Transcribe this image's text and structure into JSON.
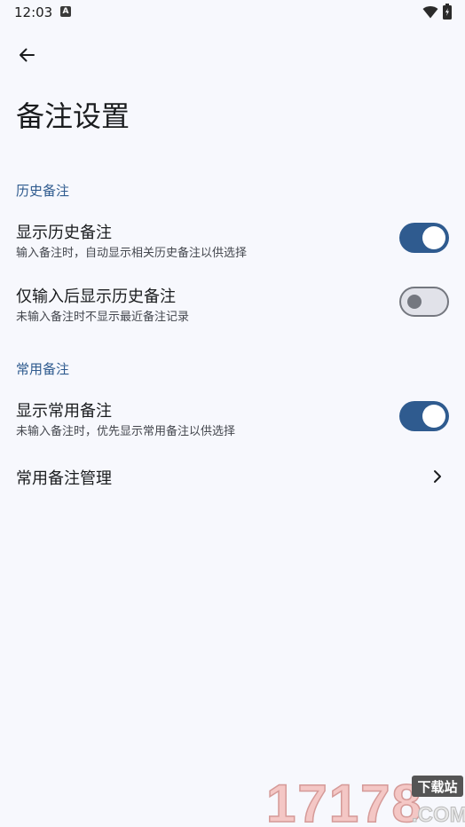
{
  "status_bar": {
    "time": "12:03",
    "notification_icon": "A"
  },
  "header": {
    "title": "备注设置"
  },
  "sections": [
    {
      "title": "历史备注",
      "items": [
        {
          "title": "显示历史备注",
          "summary": "输入备注时，自动显示相关历史备注以供选择",
          "enabled": true
        },
        {
          "title": "仅输入后显示历史备注",
          "summary": "未输入备注时不显示最近备注记录",
          "enabled": false
        }
      ]
    },
    {
      "title": "常用备注",
      "items": [
        {
          "title": "显示常用备注",
          "summary": "未输入备注时，优先显示常用备注以供选择",
          "enabled": true
        },
        {
          "title": "常用备注管理"
        }
      ]
    }
  ],
  "watermark": {
    "number": "17178",
    "tag": "下载站",
    "domain": ".COM"
  },
  "colors": {
    "accent": "#2f5b8f",
    "background": "#f7f8fd"
  }
}
